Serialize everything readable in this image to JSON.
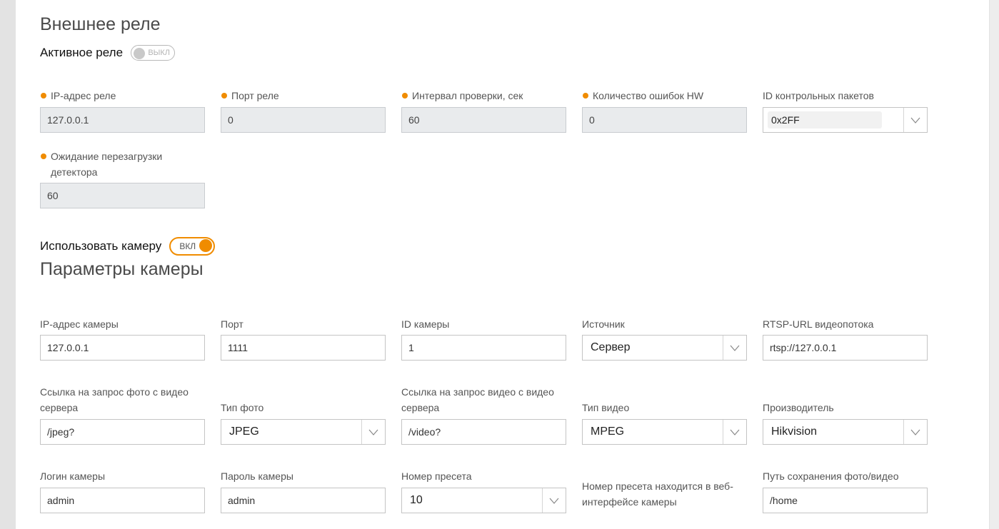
{
  "relay": {
    "title": "Внешнее реле",
    "active_toggle": {
      "label": "Активное реле",
      "state_text": "ВЫКЛ"
    },
    "fields": {
      "ip": {
        "label": "IP-адрес реле",
        "value": "127.0.0.1"
      },
      "port": {
        "label": "Порт реле",
        "value": "0"
      },
      "interval": {
        "label": "Интервал проверки, сек",
        "value": "60"
      },
      "hw_errors": {
        "label": "Количество ошибок HW",
        "value": "0"
      },
      "packet_id": {
        "label": "ID контрольных пакетов",
        "value": "0x2FF"
      },
      "reboot_wait": {
        "label": "Ожидание перезагрузки детектора",
        "value": "60"
      }
    }
  },
  "camera_toggle": {
    "label": "Использовать камеру",
    "state_text": "ВКЛ"
  },
  "camera": {
    "title": "Параметры камеры",
    "fields": {
      "ip": {
        "label": "IP-адрес камеры",
        "value": "127.0.0.1"
      },
      "port": {
        "label": "Порт",
        "value": "1111"
      },
      "camera_id": {
        "label": "ID камеры",
        "value": "1"
      },
      "source": {
        "label": "Источник",
        "value": "Сервер"
      },
      "rtsp": {
        "label": "RTSP-URL видеопотока",
        "value": "rtsp://127.0.0.1"
      },
      "photo_url": {
        "label": "Ссылка на запрос фото с видео сервера",
        "value": "/jpeg?"
      },
      "photo_type": {
        "label": "Тип фото",
        "value": "JPEG"
      },
      "video_url": {
        "label": "Ссылка на запрос видео с видео сервера",
        "value": "/video?"
      },
      "video_type": {
        "label": "Тип видео",
        "value": "MPEG"
      },
      "vendor": {
        "label": "Производитель",
        "value": "Hikvision"
      },
      "login": {
        "label": "Логин камеры",
        "value": "admin"
      },
      "password": {
        "label": "Пароль камеры",
        "value": "admin"
      },
      "preset": {
        "label": "Номер пресета",
        "value": "10"
      },
      "preset_note": "Номер пресета находится в веб-интерфейсе камеры",
      "save_path": {
        "label": "Путь сохранения фото/видео",
        "value": "/home"
      }
    }
  },
  "colors": {
    "accent": "#f08c00",
    "disabled_bg": "#e9ebed",
    "border": "#c4c4c4"
  }
}
